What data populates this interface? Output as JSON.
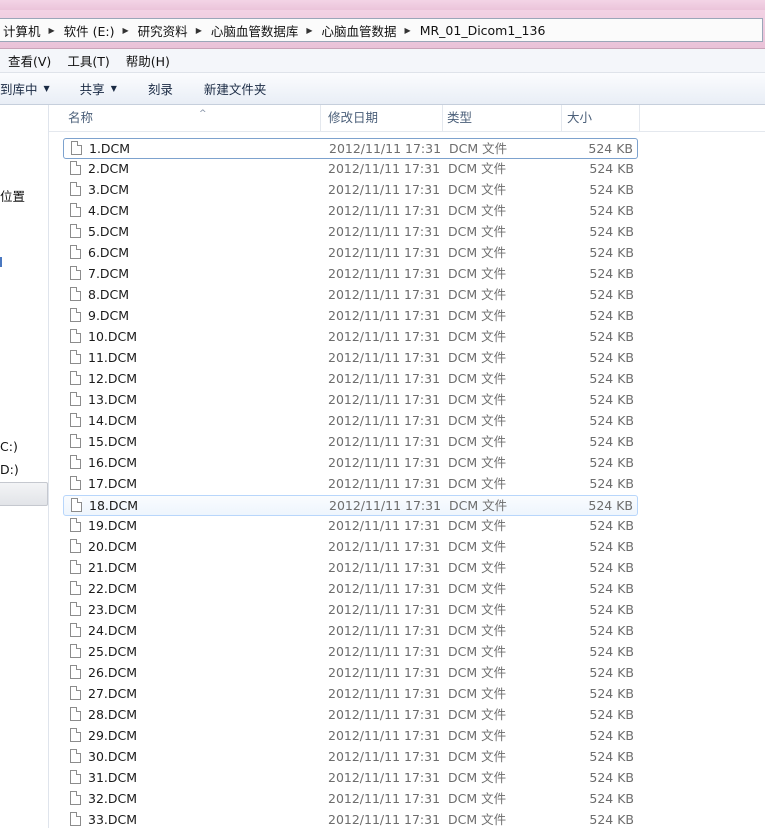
{
  "address": {
    "crumbs": [
      "计算机",
      "软件 (E:)",
      "研究资料",
      "心脑血管数据库",
      "心脑血管数据",
      "MR_01_Dicom1_136"
    ]
  },
  "menu": [
    "查看(V)",
    "工具(T)",
    "帮助(H)"
  ],
  "toolbar": {
    "library": "到库中",
    "share": "共享",
    "burn": "刻录",
    "new_folder": "新建文件夹"
  },
  "nav": {
    "location": "位置",
    "drive_c": "C:)",
    "drive_d": "D:)"
  },
  "columns": {
    "name": "名称",
    "date": "修改日期",
    "type": "类型",
    "size": "大小"
  },
  "files": [
    {
      "name": "1.DCM",
      "date": "2012/11/11 17:31",
      "type": "DCM 文件",
      "size": "524 KB"
    },
    {
      "name": "2.DCM",
      "date": "2012/11/11 17:31",
      "type": "DCM 文件",
      "size": "524 KB"
    },
    {
      "name": "3.DCM",
      "date": "2012/11/11 17:31",
      "type": "DCM 文件",
      "size": "524 KB"
    },
    {
      "name": "4.DCM",
      "date": "2012/11/11 17:31",
      "type": "DCM 文件",
      "size": "524 KB"
    },
    {
      "name": "5.DCM",
      "date": "2012/11/11 17:31",
      "type": "DCM 文件",
      "size": "524 KB"
    },
    {
      "name": "6.DCM",
      "date": "2012/11/11 17:31",
      "type": "DCM 文件",
      "size": "524 KB"
    },
    {
      "name": "7.DCM",
      "date": "2012/11/11 17:31",
      "type": "DCM 文件",
      "size": "524 KB"
    },
    {
      "name": "8.DCM",
      "date": "2012/11/11 17:31",
      "type": "DCM 文件",
      "size": "524 KB"
    },
    {
      "name": "9.DCM",
      "date": "2012/11/11 17:31",
      "type": "DCM 文件",
      "size": "524 KB"
    },
    {
      "name": "10.DCM",
      "date": "2012/11/11 17:31",
      "type": "DCM 文件",
      "size": "524 KB"
    },
    {
      "name": "11.DCM",
      "date": "2012/11/11 17:31",
      "type": "DCM 文件",
      "size": "524 KB"
    },
    {
      "name": "12.DCM",
      "date": "2012/11/11 17:31",
      "type": "DCM 文件",
      "size": "524 KB"
    },
    {
      "name": "13.DCM",
      "date": "2012/11/11 17:31",
      "type": "DCM 文件",
      "size": "524 KB"
    },
    {
      "name": "14.DCM",
      "date": "2012/11/11 17:31",
      "type": "DCM 文件",
      "size": "524 KB"
    },
    {
      "name": "15.DCM",
      "date": "2012/11/11 17:31",
      "type": "DCM 文件",
      "size": "524 KB"
    },
    {
      "name": "16.DCM",
      "date": "2012/11/11 17:31",
      "type": "DCM 文件",
      "size": "524 KB"
    },
    {
      "name": "17.DCM",
      "date": "2012/11/11 17:31",
      "type": "DCM 文件",
      "size": "524 KB"
    },
    {
      "name": "18.DCM",
      "date": "2012/11/11 17:31",
      "type": "DCM 文件",
      "size": "524 KB"
    },
    {
      "name": "19.DCM",
      "date": "2012/11/11 17:31",
      "type": "DCM 文件",
      "size": "524 KB"
    },
    {
      "name": "20.DCM",
      "date": "2012/11/11 17:31",
      "type": "DCM 文件",
      "size": "524 KB"
    },
    {
      "name": "21.DCM",
      "date": "2012/11/11 17:31",
      "type": "DCM 文件",
      "size": "524 KB"
    },
    {
      "name": "22.DCM",
      "date": "2012/11/11 17:31",
      "type": "DCM 文件",
      "size": "524 KB"
    },
    {
      "name": "23.DCM",
      "date": "2012/11/11 17:31",
      "type": "DCM 文件",
      "size": "524 KB"
    },
    {
      "name": "24.DCM",
      "date": "2012/11/11 17:31",
      "type": "DCM 文件",
      "size": "524 KB"
    },
    {
      "name": "25.DCM",
      "date": "2012/11/11 17:31",
      "type": "DCM 文件",
      "size": "524 KB"
    },
    {
      "name": "26.DCM",
      "date": "2012/11/11 17:31",
      "type": "DCM 文件",
      "size": "524 KB"
    },
    {
      "name": "27.DCM",
      "date": "2012/11/11 17:31",
      "type": "DCM 文件",
      "size": "524 KB"
    },
    {
      "name": "28.DCM",
      "date": "2012/11/11 17:31",
      "type": "DCM 文件",
      "size": "524 KB"
    },
    {
      "name": "29.DCM",
      "date": "2012/11/11 17:31",
      "type": "DCM 文件",
      "size": "524 KB"
    },
    {
      "name": "30.DCM",
      "date": "2012/11/11 17:31",
      "type": "DCM 文件",
      "size": "524 KB"
    },
    {
      "name": "31.DCM",
      "date": "2012/11/11 17:31",
      "type": "DCM 文件",
      "size": "524 KB"
    },
    {
      "name": "32.DCM",
      "date": "2012/11/11 17:31",
      "type": "DCM 文件",
      "size": "524 KB"
    },
    {
      "name": "33.DCM",
      "date": "2012/11/11 17:31",
      "type": "DCM 文件",
      "size": "524 KB"
    }
  ]
}
